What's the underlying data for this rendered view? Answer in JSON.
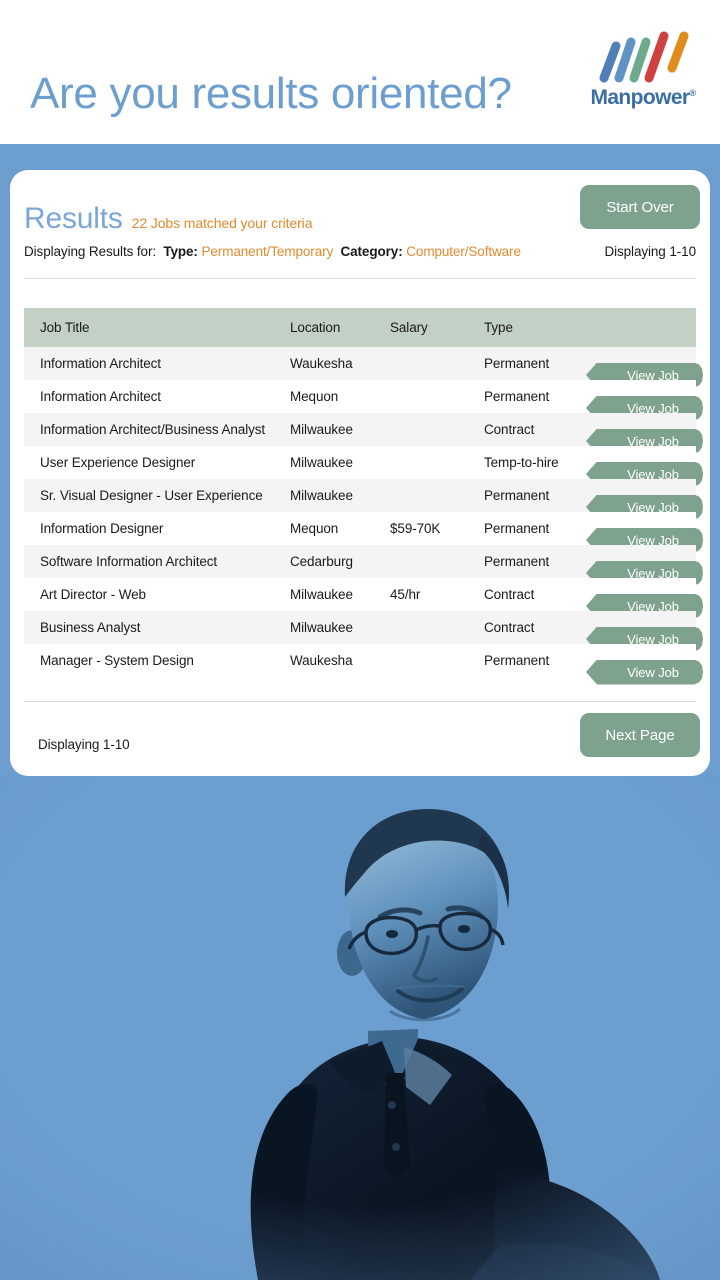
{
  "banner": {
    "headline": "Are you results oriented?",
    "logo": {
      "wordmark": "Manpower",
      "registered_mark": "®",
      "bar_colors": [
        "#4f7fb4",
        "#5f93c4",
        "#6fa98c",
        "#cf4040",
        "#e08b1e"
      ]
    }
  },
  "card": {
    "title": "Results",
    "subtitle": "22 Jobs matched your criteria",
    "criteria": {
      "prefix": "Displaying Results for:",
      "type_label": "Type:",
      "type_value": "Permanent/Temporary",
      "category_label": "Category:",
      "category_value": "Computer/Software"
    },
    "displaying_top": "Displaying 1-10",
    "displaying_bottom": "Displaying 1-10",
    "start_over_label": "Start Over",
    "next_page_label": "Next Page",
    "columns": [
      "Job Title",
      "Location",
      "Salary",
      "Type",
      ""
    ],
    "action_label": "View Job",
    "rows": [
      {
        "title": "Information Architect",
        "location": "Waukesha",
        "salary": "",
        "type": "Permanent"
      },
      {
        "title": "Information Architect",
        "location": "Mequon",
        "salary": "",
        "type": "Permanent"
      },
      {
        "title": "Information Architect/Business Analyst",
        "location": "Milwaukee",
        "salary": "",
        "type": "Contract"
      },
      {
        "title": "User Experience Designer",
        "location": "Milwaukee",
        "salary": "",
        "type": "Temp-to-hire"
      },
      {
        "title": "Sr. Visual Designer - User Experience",
        "location": "Milwaukee",
        "salary": "",
        "type": "Permanent"
      },
      {
        "title": "Information Designer",
        "location": "Mequon",
        "salary": "$59-70K",
        "type": "Permanent"
      },
      {
        "title": "Software Information Architect",
        "location": "Cedarburg",
        "salary": "",
        "type": "Permanent"
      },
      {
        "title": "Art Director - Web",
        "location": "Milwaukee",
        "salary": "45/hr",
        "type": "Contract"
      },
      {
        "title": "Business Analyst",
        "location": "Milwaukee",
        "salary": "",
        "type": "Contract"
      },
      {
        "title": "Manager - System Design",
        "location": "Waukesha",
        "salary": "",
        "type": "Permanent"
      }
    ]
  },
  "photo": {
    "description": "Duotone blue photograph of a seated middle-aged man with glasses looking upward"
  },
  "colors": {
    "page_blue": "#6d9ed0",
    "headline_blue": "#6d9ed0",
    "title_blue": "#7aa7d6",
    "accent_orange": "#e08b2e",
    "button_green": "#7ea28d",
    "table_header_green": "#c2d0c5",
    "row_alt_gray": "#f4f4f4"
  }
}
